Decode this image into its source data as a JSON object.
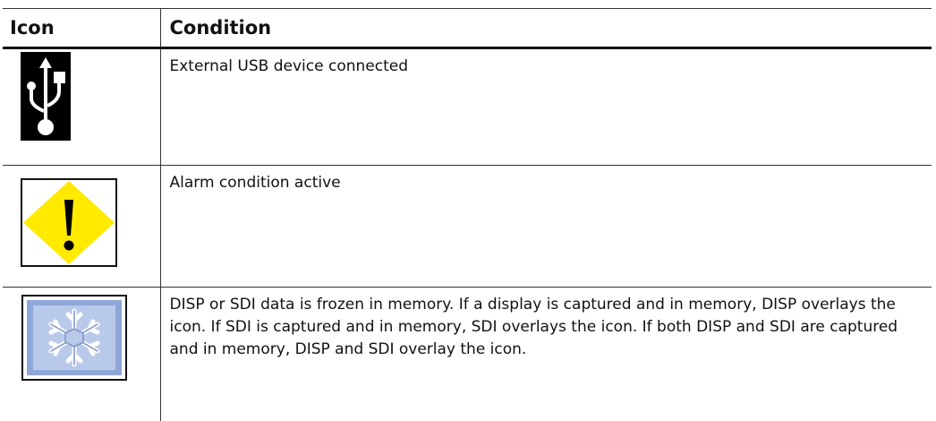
{
  "table": {
    "headers": {
      "icon": "Icon",
      "condition": "Condition"
    },
    "rows": [
      {
        "icon": "usb-icon",
        "condition": "External USB device connected"
      },
      {
        "icon": "alarm-warning-icon",
        "condition": "Alarm condition active"
      },
      {
        "icon": "snowflake-frozen-icon",
        "condition": "DISP or SDI data is frozen in memory. If a display is captured and in memory, DISP overlays the icon. If SDI is captured and in memory, SDI overlays the icon. If both DISP and SDI are captured and in memory, DISP and SDI overlay the icon."
      }
    ]
  },
  "colors": {
    "warning_yellow": "#ffea00",
    "usb_background": "#000000",
    "frozen_blue": "#8fa6d8"
  }
}
